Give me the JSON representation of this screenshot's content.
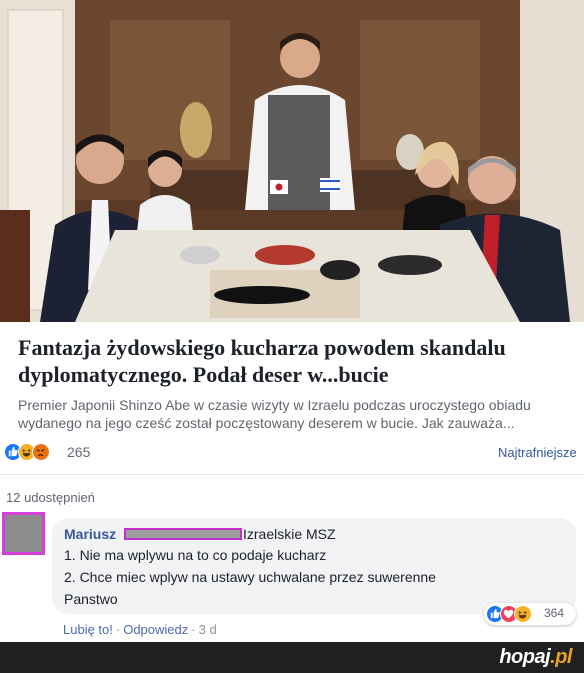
{
  "link_preview": {
    "headline": "Fantazja żydowskiego kucharza powodem skandalu dyplomatycznego. Podał deser w...bucie",
    "description_line1": "Premier Japonii Shinzo Abe w czasie wizyty w Izraelu podczas uroczystego obiadu",
    "description_line2": "wydanego na jego cześć został poczęstowany deserem w bucie. Jak zauważa..."
  },
  "reactions": {
    "icons": [
      "like-icon",
      "haha-icon",
      "angry-icon"
    ],
    "count": "265",
    "sort_label": "Najtrafniejsze"
  },
  "shares_label": "12 udostępnień",
  "comment": {
    "author": "Mariusz",
    "tag": "Izraelskie MSZ",
    "line1": "1. Nie ma wplywu na to co podaje kucharz",
    "line2": "2. Chce miec wplyw na ustawy uchwalane przez suwerenne",
    "line3": "Panstwo",
    "reaction_icons": [
      "like-icon",
      "love-icon",
      "haha-icon"
    ],
    "reaction_count": "364",
    "like_label": "Lubię to!",
    "reply_label": "Odpowiedz",
    "time": "3 d"
  },
  "watermark": {
    "text": "hopaj",
    "suffix": ".pl"
  },
  "colors": {
    "link": "#365899",
    "like": "#1877f2",
    "love": "#f33e58",
    "haha": "#f7b125",
    "angry": "#e9710f",
    "highlight": "#d53fd9"
  }
}
